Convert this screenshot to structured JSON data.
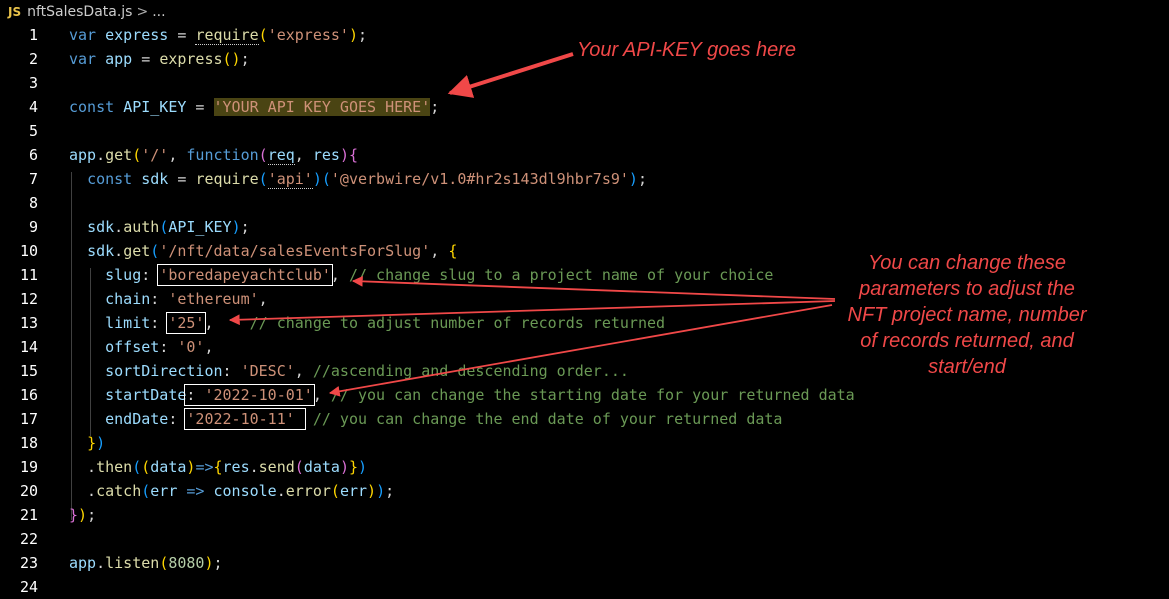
{
  "breadcrumb": {
    "file_icon": "JS",
    "filename": "nftSalesData.js",
    "separator": ">",
    "more": "..."
  },
  "lines": [
    {
      "n": "1",
      "t": "var express = require('express');"
    },
    {
      "n": "2",
      "t": "var app = express();"
    },
    {
      "n": "3",
      "t": ""
    },
    {
      "n": "4",
      "t": "const API_KEY = 'YOUR API KEY GOES HERE';"
    },
    {
      "n": "5",
      "t": ""
    },
    {
      "n": "6",
      "t": "app.get('/', function(req, res){"
    },
    {
      "n": "7",
      "t": "const sdk = require('api')('@verbwire/v1.0#hr2s143dl9hbr7s9');"
    },
    {
      "n": "8",
      "t": ""
    },
    {
      "n": "9",
      "t": "sdk.auth(API_KEY);"
    },
    {
      "n": "10",
      "t": "sdk.get('/nft/data/salesEventsForSlug', {"
    },
    {
      "n": "11",
      "t": "slug: 'boredapeyachtclub', // change slug to a project name of your choice"
    },
    {
      "n": "12",
      "t": "chain: 'ethereum',"
    },
    {
      "n": "13",
      "t": "limit: '25',    // change to adjust number of records returned"
    },
    {
      "n": "14",
      "t": "offset: '0',"
    },
    {
      "n": "15",
      "t": "sortDirection: 'DESC', //ascending and descending order..."
    },
    {
      "n": "16",
      "t": "startDate: '2022-10-01', // you can change the starting date for your returned data"
    },
    {
      "n": "17",
      "t": "endDate: '2022-10-11'  // you can change the end date of your returned data"
    },
    {
      "n": "18",
      "t": "})"
    },
    {
      "n": "19",
      "t": ".then((data)=>{res.send(data)})"
    },
    {
      "n": "20",
      "t": ".catch(err => console.error(err));"
    },
    {
      "n": "21",
      "t": "});"
    },
    {
      "n": "22",
      "t": ""
    },
    {
      "n": "23",
      "t": "app.listen(8080);"
    },
    {
      "n": "24",
      "t": ""
    }
  ],
  "annotations": {
    "api_key_note": "Your API-KEY goes here",
    "params_note": "You can change these parameters to adjust the NFT project name, number of records returned, and start/end"
  },
  "colors": {
    "background": "#000000",
    "keyword": "#569cd6",
    "variable": "#9cdcfe",
    "function": "#dcdcaa",
    "string": "#ce9178",
    "comment": "#6a9955",
    "annotation": "#f04848"
  }
}
